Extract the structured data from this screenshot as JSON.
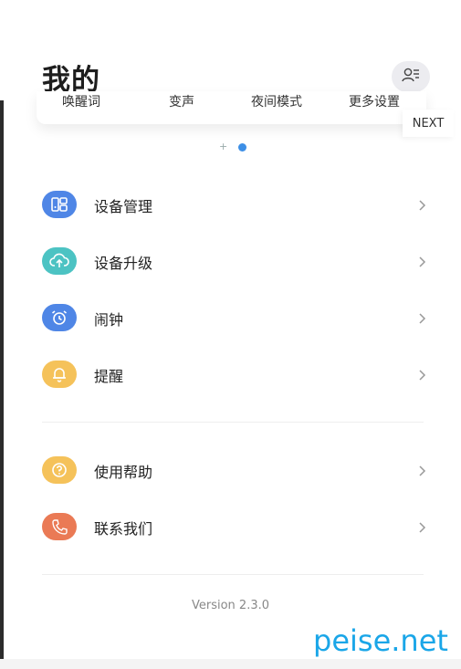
{
  "header": {
    "title": "我的"
  },
  "quick_settings": {
    "items": [
      {
        "label": "唤醒词"
      },
      {
        "label": "变声"
      },
      {
        "label": "夜间模式"
      },
      {
        "label": "更多设置"
      }
    ],
    "next_label": "NEXT",
    "pager_plus": "+"
  },
  "menu_group_1": [
    {
      "label": "设备管理",
      "icon": "device-management-icon",
      "color": "#4f86e6"
    },
    {
      "label": "设备升级",
      "icon": "cloud-upload-icon",
      "color": "#4cc3c3"
    },
    {
      "label": "闹钟",
      "icon": "alarm-clock-icon",
      "color": "#4f86e6"
    },
    {
      "label": "提醒",
      "icon": "bell-icon",
      "color": "#f5c25a"
    }
  ],
  "menu_group_2": [
    {
      "label": "使用帮助",
      "icon": "help-icon",
      "color": "#f5c25a"
    },
    {
      "label": "联系我们",
      "icon": "phone-icon",
      "color": "#ea7a55"
    }
  ],
  "footer": {
    "version": "Version 2.3.0"
  },
  "watermark": {
    "text": "peise.net"
  },
  "colors": {
    "accent": "#3d8fe6",
    "page_bg": "#ffffff"
  }
}
